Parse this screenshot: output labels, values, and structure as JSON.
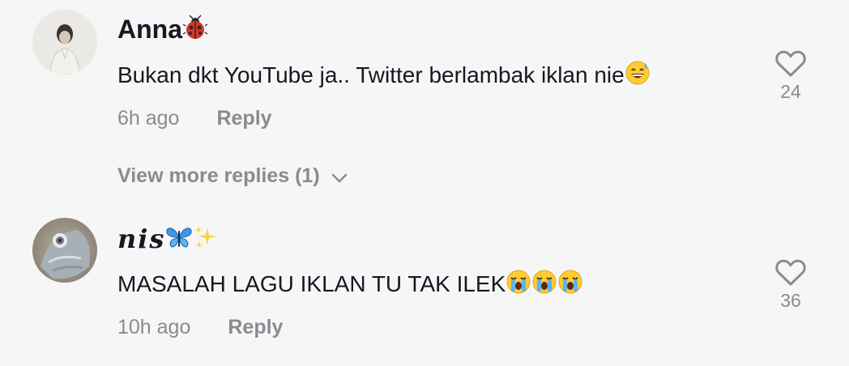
{
  "comments": [
    {
      "username": "Anna",
      "username_emoji": "ladybug-icon",
      "text": "Bukan dkt YouTube ja.. Twitter berlambak iklan nie",
      "text_emoji": "grinning-sweat-emoji",
      "time": "6h ago",
      "reply_label": "Reply",
      "likes": "24"
    },
    {
      "username": "𝒏𝒊𝒔",
      "username_emoji": "butterfly-sparkles-icon",
      "text": "MASALAH LAGU IKLAN TU TAK ILEK",
      "text_emoji": "crying-face-emoji x3",
      "time": "10h ago",
      "reply_label": "Reply",
      "likes": "36"
    }
  ],
  "view_more_replies": "View more replies (1)",
  "colors": {
    "background": "#f6f6f6",
    "primary_text": "#161823",
    "secondary_text": "#8a8b91"
  }
}
